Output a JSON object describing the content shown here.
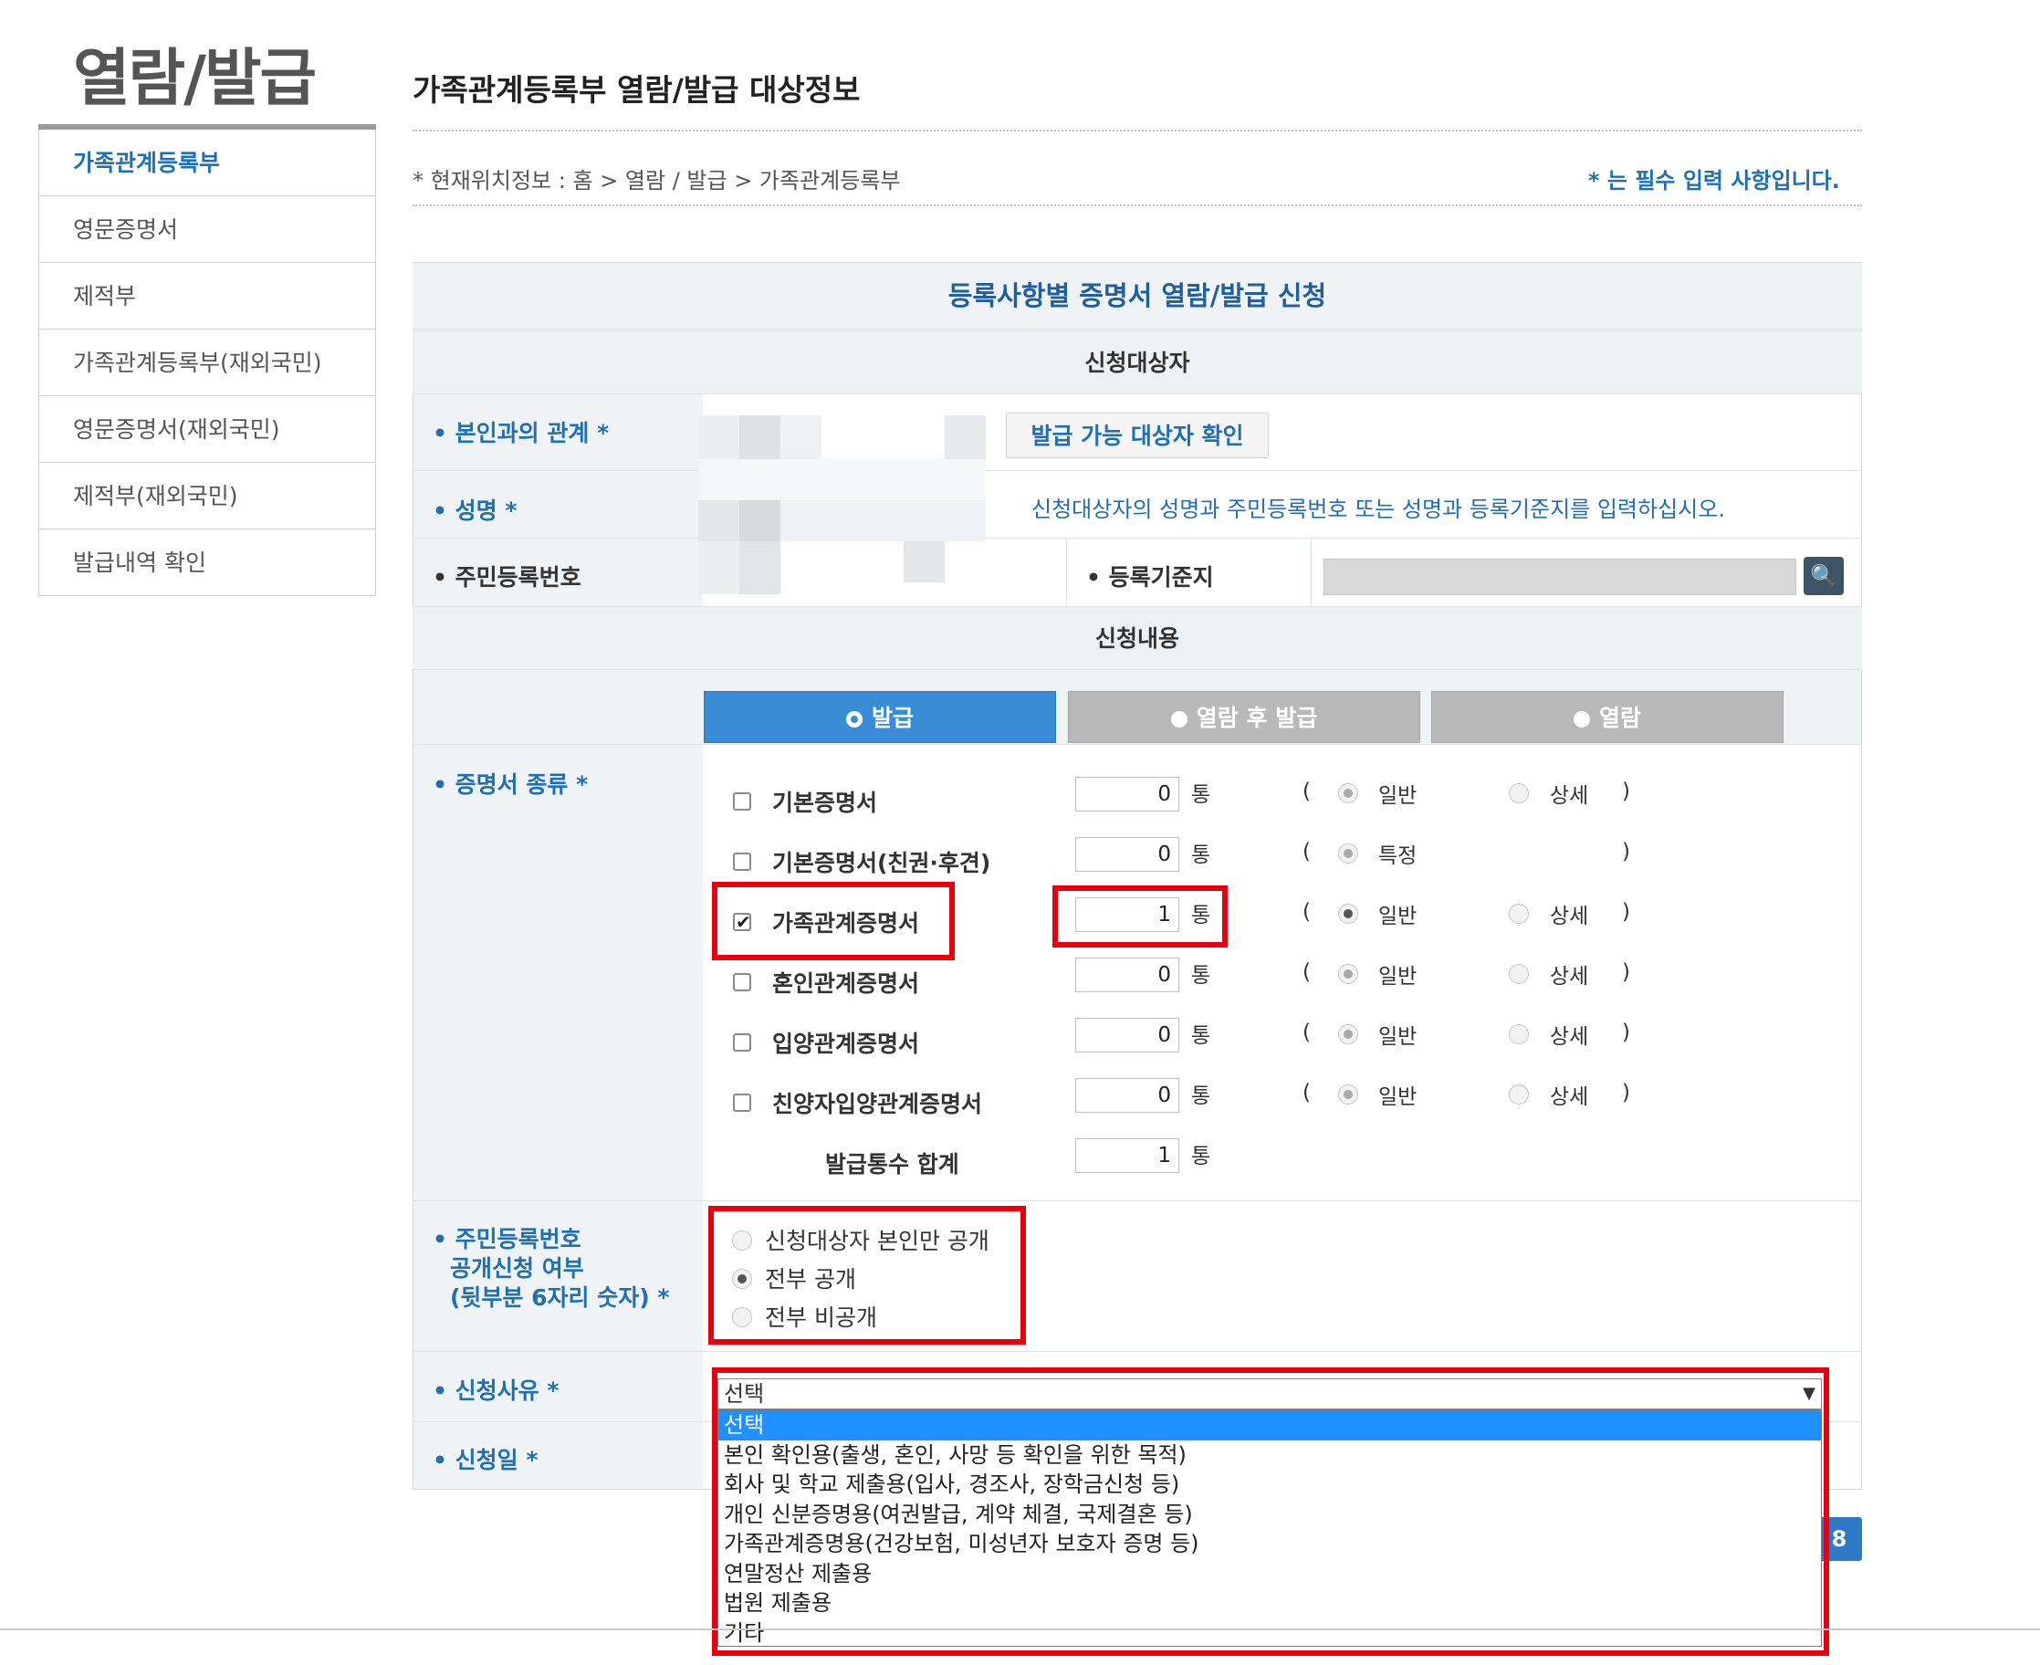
{
  "sidebar": {
    "title": "열람/발급",
    "items": [
      "가족관계등록부",
      "영문증명서",
      "제적부",
      "가족관계등록부(재외국민)",
      "영문증명서(재외국민)",
      "제적부(재외국민)",
      "발급내역 확인"
    ]
  },
  "header": {
    "title": "가족관계등록부 열람/발급 대상정보",
    "breadcrumb": "* 현재위치정보 : 홈 > 열람 / 발급 > 가족관계등록부",
    "required_note": "* 는 필수 입력 사항입니다."
  },
  "form": {
    "title": "등록사항별 증명서 열람/발급 신청",
    "section_applicant": "신청대상자",
    "relation_label": "• 본인과의 관계 *",
    "check_button": "발급 가능 대상자 확인",
    "name_label": "• 성명 *",
    "hint": "신청대상자의 성명과 주민등록번호 또는 성명과 등록기준지를 입력하십시오.",
    "rrn_label": "• 주민등록번호",
    "base_label": "• 등록기준지",
    "search_icon": "🔍",
    "section_content": "신청내용",
    "tabs": [
      "발급",
      "열람 후 발급",
      "열람"
    ],
    "cert_label": "• 증명서 종류 *",
    "certs": [
      {
        "name": "기본증명서",
        "count": "0",
        "opt1": "일반",
        "opt2": "상세"
      },
      {
        "name": "기본증명서(친권·후견)",
        "count": "0",
        "opt1": "특정",
        "opt2": ""
      },
      {
        "name": "가족관계증명서",
        "count": "1",
        "opt1": "일반",
        "opt2": "상세"
      },
      {
        "name": "혼인관계증명서",
        "count": "0",
        "opt1": "일반",
        "opt2": "상세"
      },
      {
        "name": "입양관계증명서",
        "count": "0",
        "opt1": "일반",
        "opt2": "상세"
      },
      {
        "name": "친양자입양관계증명서",
        "count": "0",
        "opt1": "일반",
        "opt2": "상세"
      }
    ],
    "unit": "통",
    "paren_open": "(",
    "paren_close": ")",
    "total_label": "발급통수 합계",
    "total_count": "1",
    "disclosure_label_1": "• 주민등록번호",
    "disclosure_label_2": "공개신청 여부",
    "disclosure_label_3": "(뒷부분 6자리 숫자) *",
    "disclosure_options": [
      "신청대상자 본인만 공개",
      "전부 공개",
      "전부 비공개"
    ],
    "reason_label": "• 신청사유 *",
    "reason_selected": "선택",
    "reason_options": [
      "선택",
      "본인 확인용(출생, 혼인, 사망 등 확인을 위한 목적)",
      "회사 및 학교 제출용(입사, 경조사, 장학금신청 등)",
      "개인 신분증명용(여권발급, 계약 체결, 국제결혼 등)",
      "가족관계증명용(건강보험, 미성년자 보호자 증명 등)",
      "연말정산 제출용",
      "법원 제출용",
      "기타"
    ],
    "date_label": "• 신청일 *",
    "blue_button_glyph": "8"
  }
}
